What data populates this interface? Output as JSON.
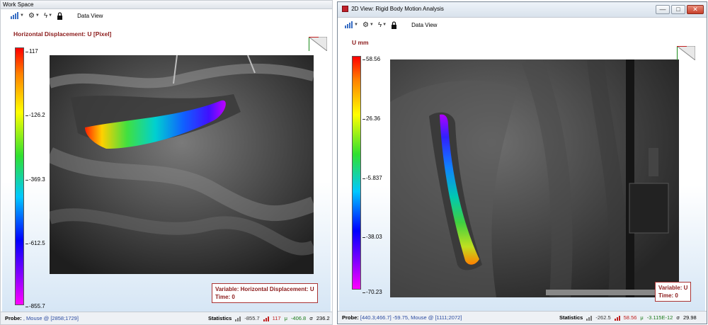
{
  "left": {
    "window_title": "Work Space",
    "toolbar": {
      "chart_icon": "bar-chart-icon",
      "gear_icon": "gear-icon",
      "lightning_icon": "lightning-icon",
      "lock_icon": "lock-icon",
      "view_label": "Data View"
    },
    "variable_title": "Horizontal Displacement: U [Pixel]",
    "colorbar_ticks": [
      "117",
      "-126.2",
      "-369.3",
      "-612.5",
      "-855.7"
    ],
    "info_box": {
      "variable": "Variable: Horizontal Displacement: U",
      "time": "Time: 0"
    },
    "status": {
      "probe_label": "Probe:",
      "probe_value": ", Mouse @ [2858;1729]",
      "statistics_label": "Statistics",
      "min": "-855.7",
      "max": "117",
      "mean": "-406.8",
      "sigma_symbol": "σ",
      "sigma": "236.2"
    }
  },
  "right": {
    "window_title": "2D View: Rigid Body Motion Analysis",
    "window_controls": {
      "minimize": "—",
      "maximize": "□",
      "close": "✕"
    },
    "toolbar": {
      "chart_icon": "bar-chart-icon",
      "gear_icon": "gear-icon",
      "lightning_icon": "lightning-icon",
      "lock_icon": "lock-icon",
      "view_label": "Data View"
    },
    "variable_title": "U mm",
    "colorbar_ticks": [
      "58.56",
      "26.36",
      "-5.837",
      "-38.03",
      "-70.23"
    ],
    "info_box": {
      "variable": "Variable: U",
      "time": "Time: 0"
    },
    "status": {
      "probe_label": "Probe:",
      "probe_value": "[440.3;466.7]  -59.75, Mouse @ [1111;2072]",
      "statistics_label": "Statistics",
      "min": "-262.5",
      "max": "58.56",
      "mean": "-3.115E-12",
      "sigma_symbol": "σ",
      "sigma": "29.98"
    }
  },
  "colors": {
    "title_red": "#8b1a1a",
    "max_red": "#c02020",
    "mean_green": "#1a7a1a",
    "probe_blue": "#2a4aa0"
  }
}
